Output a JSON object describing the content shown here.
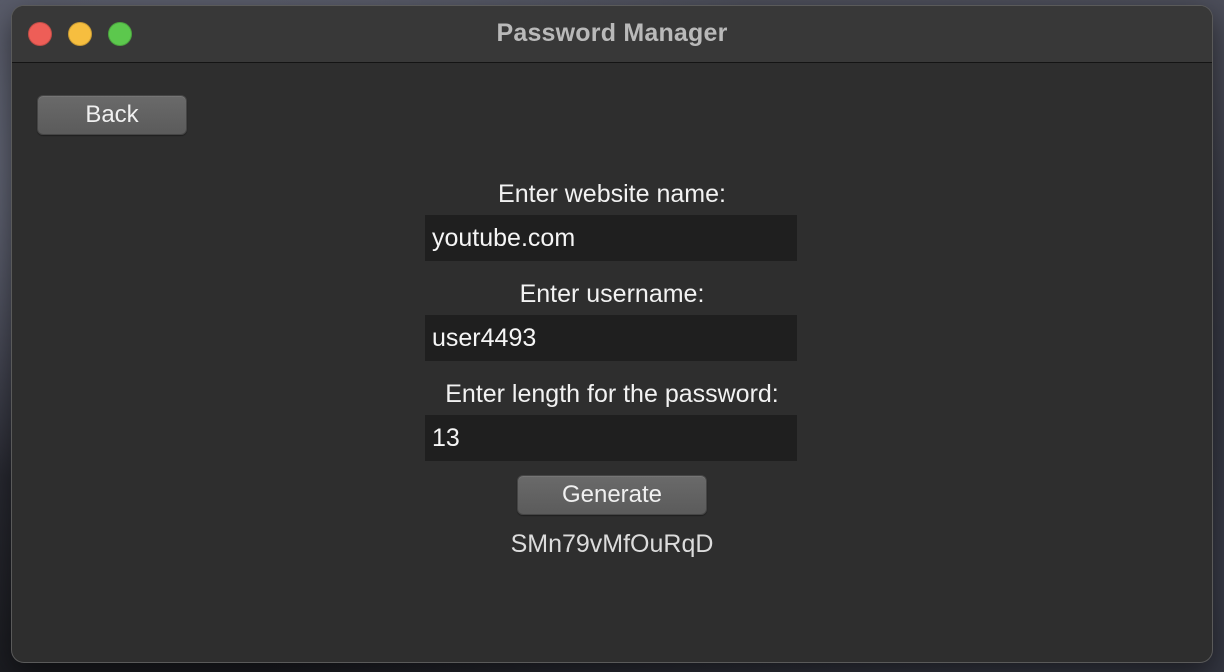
{
  "window": {
    "title": "Password Manager"
  },
  "toolbar": {
    "back_label": "Back"
  },
  "form": {
    "website_label": "Enter website name:",
    "website_value": "youtube.com",
    "username_label": "Enter username:",
    "username_value": "user4493",
    "length_label": "Enter length for the password:",
    "length_value": "13",
    "generate_label": "Generate",
    "generated_password": "SMn79vMfOuRqD"
  },
  "colors": {
    "close": "#ee5e57",
    "minimize": "#f6be3f",
    "maximize": "#5cc84d",
    "window_bg": "#2e2e2e",
    "field_bg": "#1f1f1f"
  },
  "icons": {
    "close": "close-icon",
    "minimize": "minimize-icon",
    "maximize": "maximize-icon"
  }
}
